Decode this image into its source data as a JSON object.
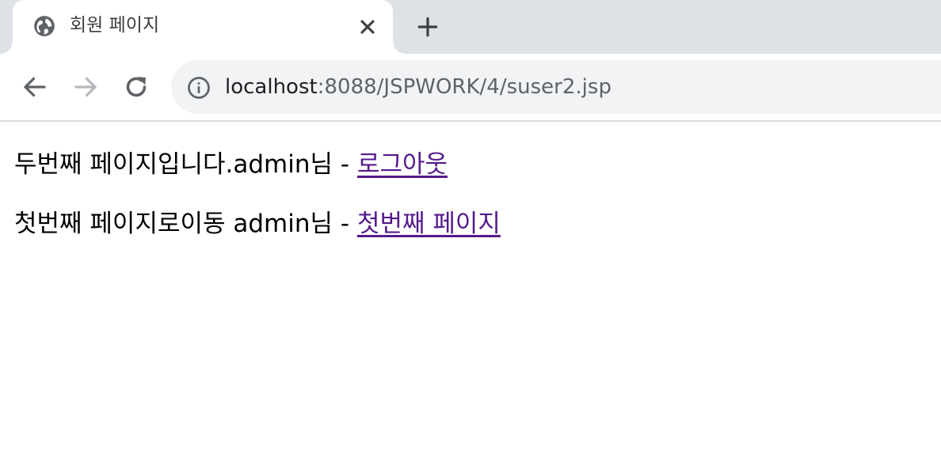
{
  "tab": {
    "title": "회원 페이지",
    "favicon": "globe-icon",
    "close_icon": "close-icon"
  },
  "new_tab_icon": "plus-icon",
  "toolbar": {
    "back_icon": "arrow-left-icon",
    "forward_icon": "arrow-right-icon",
    "reload_icon": "reload-icon",
    "info_icon": "info-icon",
    "url_host": "localhost",
    "url_path": ":8088/JSPWORK/4/suser2.jsp"
  },
  "content": {
    "line1_text": "두번째 페이지입니다.admin님 - ",
    "line1_link": "로그아웃",
    "line2_text": "첫번째 페이지로이동 admin님 - ",
    "line2_link": "첫번째 페이지"
  },
  "colors": {
    "tabstrip_bg": "#dee1e6",
    "omnibox_bg": "#f1f3f4",
    "visited_link": "#551a8b"
  }
}
